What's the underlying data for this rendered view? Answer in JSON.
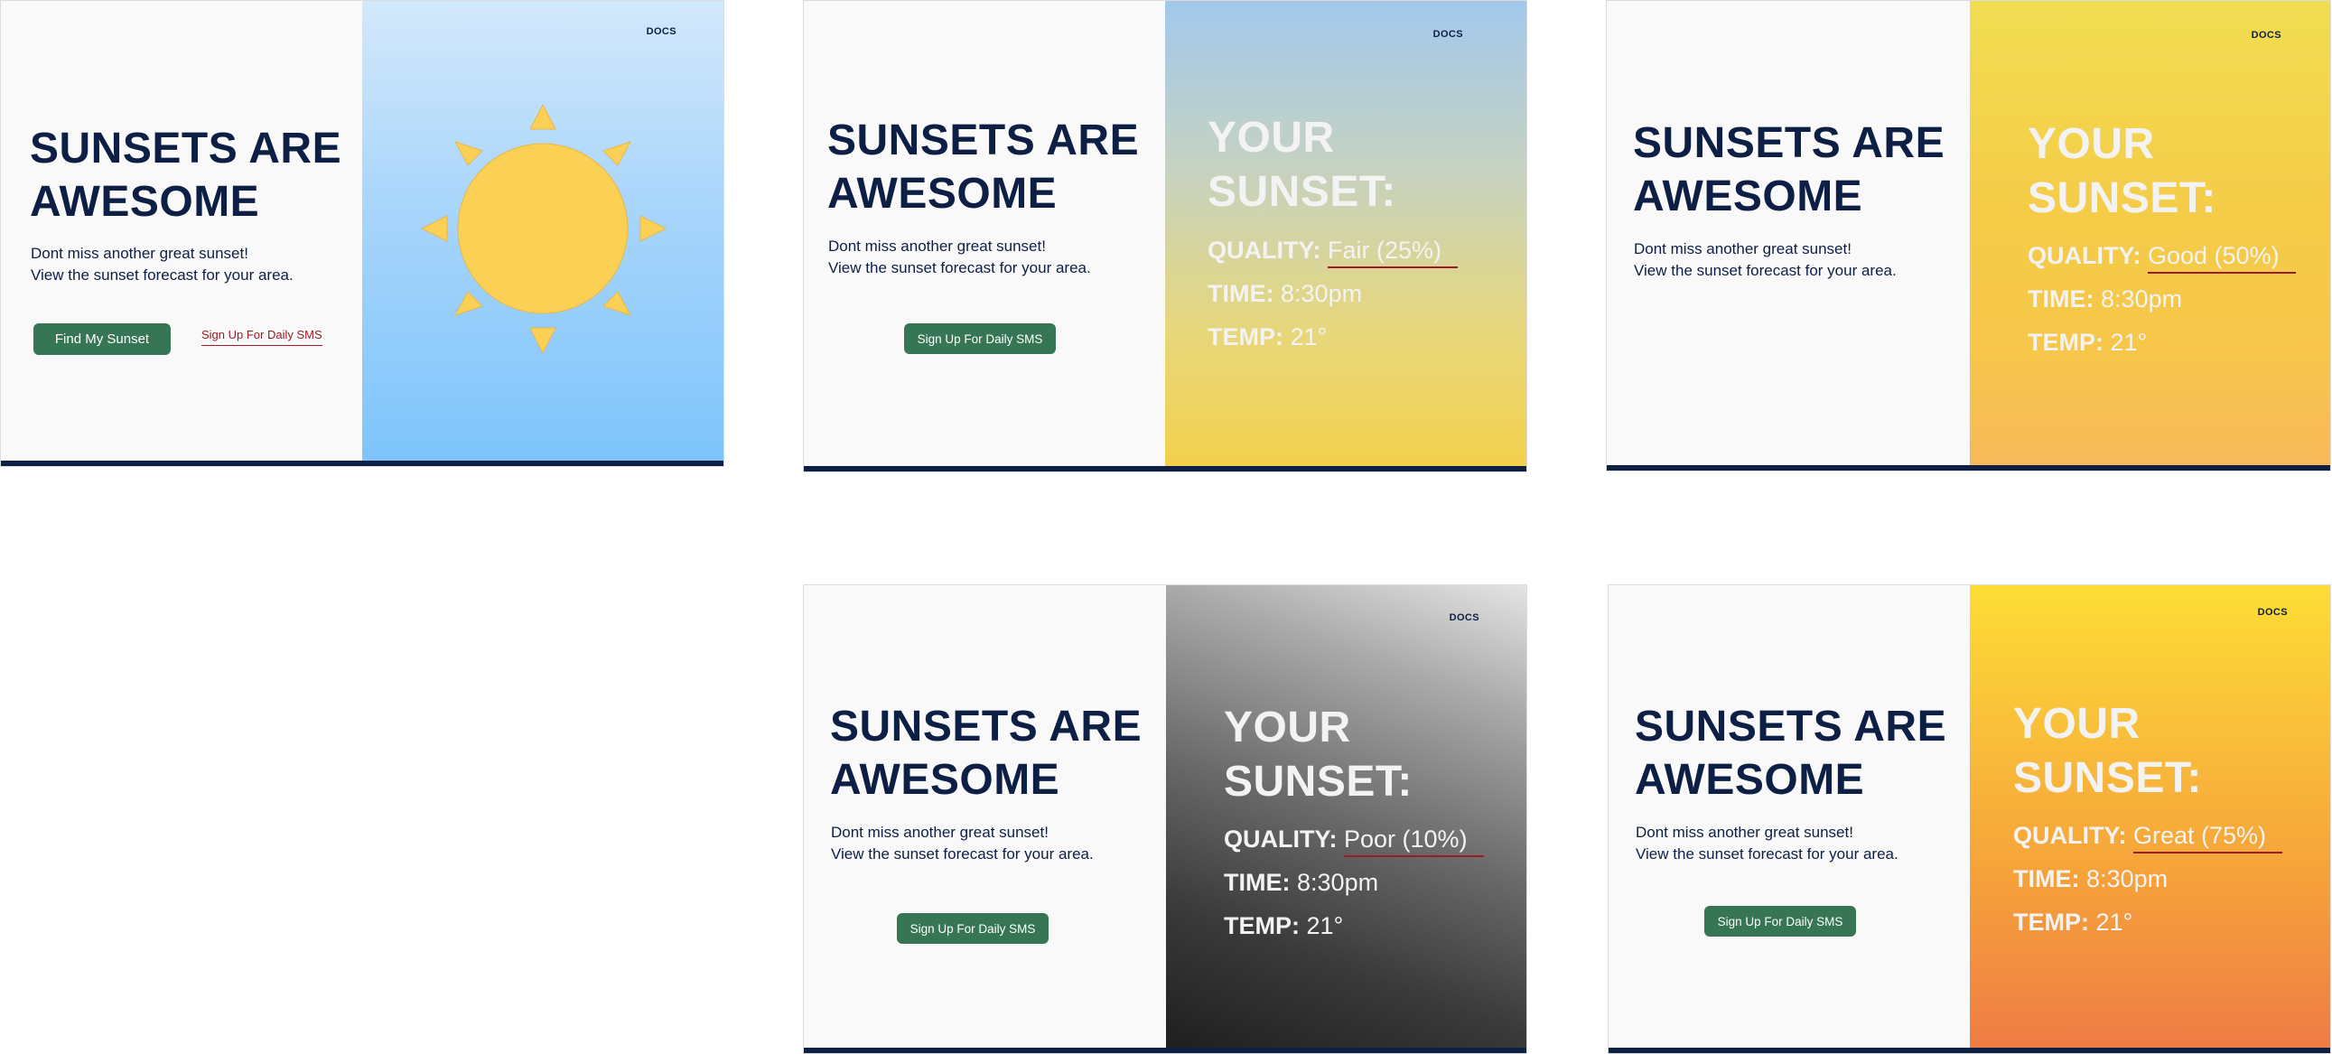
{
  "brand": {
    "headline_line1": "SUNSETS ARE",
    "headline_line2": "AWESOME",
    "sub_line1": "Dont miss another great sunset!",
    "sub_line2": "View the sunset forecast for your area.",
    "docs_label": "DOCS",
    "find_button": "Find My Sunset",
    "sms_label": "Sign Up For Daily SMS"
  },
  "forecast": {
    "title_line1": "YOUR",
    "title_line2": "SUNSET:",
    "quality_label": "QUALITY:",
    "time_label": "TIME:",
    "temp_label": "TEMP:",
    "time_value": "8:30pm",
    "temp_value": "21°"
  },
  "screens": [
    {
      "id": "landing"
    },
    {
      "id": "fair",
      "quality_value": "Fair (25%)",
      "quality_fraction": 0.25,
      "gradient": [
        "#a2c8ec",
        "#d8d2a0",
        "#f3d04a"
      ]
    },
    {
      "id": "good",
      "quality_value": "Good (50%)",
      "quality_fraction": 0.5,
      "gradient": [
        "#f0dd52",
        "#f7c64b",
        "#f7b85a"
      ]
    },
    {
      "id": "poor",
      "quality_value": "Poor (10%)",
      "quality_fraction": 0.1,
      "gradient": [
        "#dedede",
        "#6e6e6e",
        "#1f1f1f"
      ]
    },
    {
      "id": "great",
      "quality_value": "Great (75%)",
      "quality_fraction": 0.75,
      "gradient": [
        "#fddd35",
        "#f6a43a",
        "#ee7b45"
      ]
    }
  ],
  "colors": {
    "navy": "#0d1f44",
    "button_green": "#367654",
    "link_red": "#9b1c25",
    "sun_yellow": "#fccf55",
    "sky_top": "#d3e8fb",
    "sky_bottom": "#7dc4fb"
  }
}
